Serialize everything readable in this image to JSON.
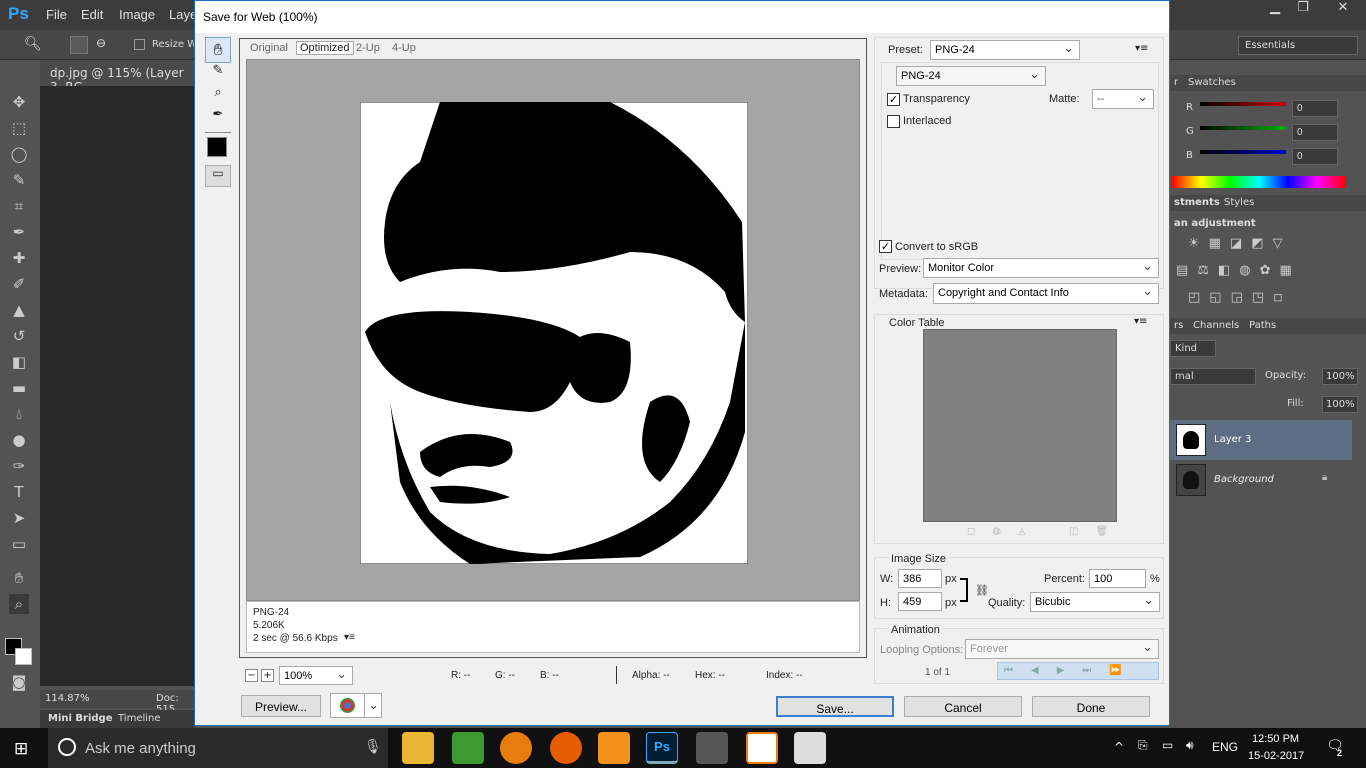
{
  "ps": {
    "logo": "Ps",
    "menu": [
      "File",
      "Edit",
      "Image",
      "Laye"
    ],
    "options": {
      "resize_label": "Resize Wi"
    },
    "workspace": "Essentials",
    "doc_tab": "dp.jpg @ 115% (Layer 3, RG",
    "zoom_status": "114.87%",
    "doc_status": "Doc: 515",
    "bottom_tabs": [
      "Mini Bridge",
      "Timeline"
    ]
  },
  "right_panels": {
    "color_tabs": [
      "r",
      "Swatches"
    ],
    "rgb": [
      {
        "label": "R",
        "value": "0",
        "color": "#d00000"
      },
      {
        "label": "G",
        "value": "0",
        "color": "#00b000"
      },
      {
        "label": "B",
        "value": "0",
        "color": "#0000d0"
      }
    ],
    "adj_tabs": [
      "stments",
      "Styles"
    ],
    "adj_title": "an adjustment",
    "layer_tabs": [
      "rs",
      "Channels",
      "Paths"
    ],
    "kind": "Kind",
    "blend": "mal",
    "opacity_label": "Opacity:",
    "opacity": "100%",
    "fill_label": "Fill:",
    "fill": "100%",
    "layers": [
      {
        "name": "Layer 3",
        "selected": true
      },
      {
        "name": "Background",
        "selected": false
      }
    ]
  },
  "dialog": {
    "title": "Save for Web (100%)",
    "view_tabs": [
      "Original",
      "Optimized",
      "2-Up",
      "4-Up"
    ],
    "active_tab": "Optimized",
    "info": {
      "format": "PNG-24",
      "size": "5.206K",
      "time": "2 sec @ 56.6 Kbps"
    },
    "zoom": "100%",
    "readout": {
      "r": "R: --",
      "g": "G: --",
      "b": "B: --",
      "alpha": "Alpha: --",
      "hex": "Hex: --",
      "index": "Index: --"
    },
    "preset_label": "Preset:",
    "preset_value": "PNG-24",
    "format_value": "PNG-24",
    "transparency_label": "Transparency",
    "matte_label": "Matte:",
    "matte_value": "--",
    "interlaced_label": "Interlaced",
    "convert_label": "Convert to sRGB",
    "preview_label": "Preview:",
    "preview_value": "Monitor Color",
    "metadata_label": "Metadata:",
    "metadata_value": "Copyright and Contact Info",
    "color_table_label": "Color Table",
    "image_size": {
      "title": "Image Size",
      "w_label": "W:",
      "w": "386",
      "h_label": "H:",
      "h": "459",
      "unit": "px",
      "percent_label": "Percent:",
      "percent": "100",
      "pct": "%",
      "quality_label": "Quality:",
      "quality": "Bicubic"
    },
    "animation": {
      "title": "Animation",
      "looping_label": "Looping Options:",
      "looping": "Forever",
      "frame": "1 of 1"
    },
    "buttons": {
      "preview": "Preview...",
      "save": "Save...",
      "cancel": "Cancel",
      "done": "Done"
    }
  },
  "taskbar": {
    "search": "Ask me anything",
    "lang": "ENG",
    "time": "12:50 PM",
    "date": "15-02-2017",
    "notif": "2"
  }
}
